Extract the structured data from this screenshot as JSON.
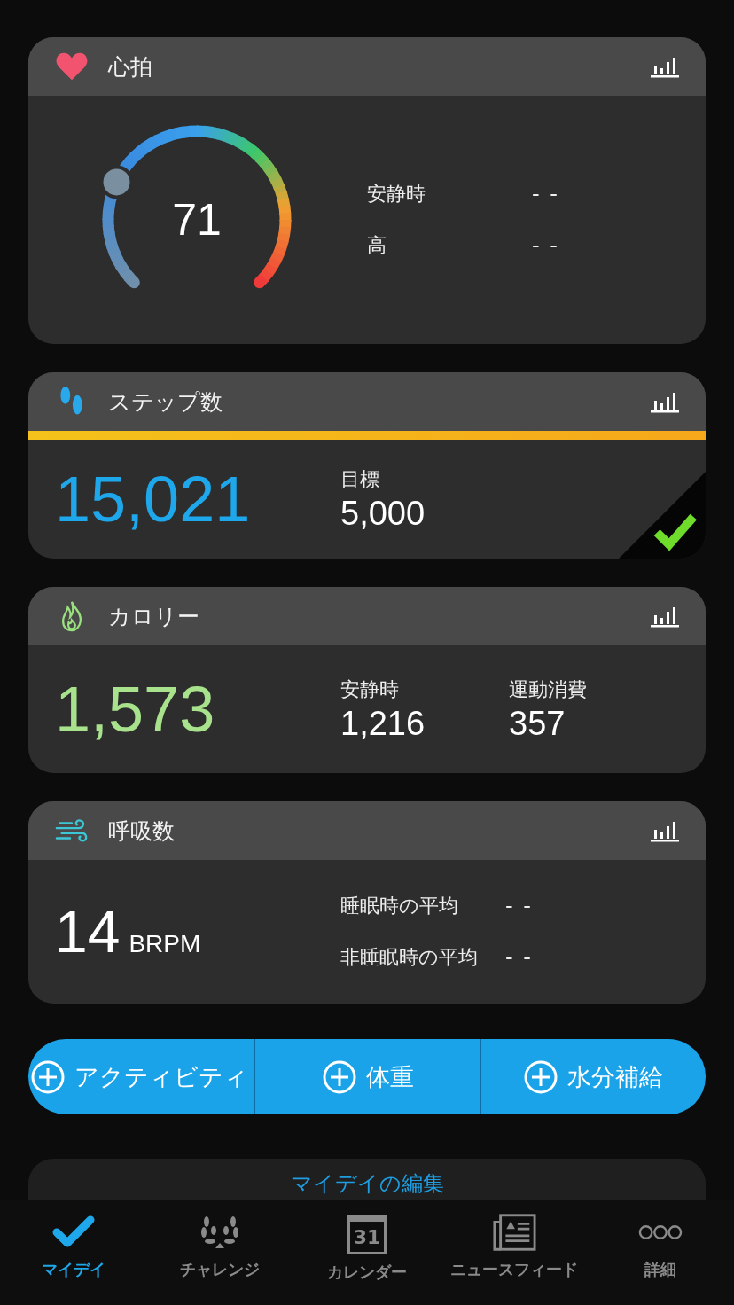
{
  "cards": [
    {
      "kind": "heart",
      "title": "心拍",
      "gauge": {
        "value": "71"
      },
      "stats": [
        {
          "label": "安静時",
          "value": "- -"
        },
        {
          "label": "高",
          "value": "- -"
        }
      ]
    },
    {
      "kind": "steps",
      "title": "ステップ数",
      "progress": {
        "level": 1
      },
      "value": "15,021",
      "goal_label": "目標",
      "goal_value": "5,000",
      "goal_met": true
    },
    {
      "kind": "calories",
      "title": "カロリー",
      "value": "1,573",
      "stats": [
        {
          "label": "安静時",
          "value": "1,216"
        },
        {
          "label": "運動消費",
          "value": "357"
        }
      ]
    },
    {
      "kind": "breath",
      "title": "呼吸数",
      "value": "14",
      "unit": "BRPM",
      "stats": [
        {
          "label": "睡眠時の平均",
          "value": "- -"
        },
        {
          "label": "非睡眠時の平均",
          "value": "- -"
        }
      ]
    }
  ],
  "add_buttons": [
    "アクティビティ",
    "体重",
    "水分補給"
  ],
  "edit_link": "マイデイの編集",
  "nav": [
    {
      "kind": "myday",
      "label": "マイデイ",
      "selected": true
    },
    {
      "kind": "challenge",
      "label": "チャレンジ",
      "selected": false
    },
    {
      "kind": "calendar",
      "label": "カレンダー",
      "day": "31",
      "selected": false
    },
    {
      "kind": "news",
      "label": "ニュースフィード",
      "selected": false
    },
    {
      "kind": "more",
      "label": "詳細",
      "selected": false
    }
  ]
}
